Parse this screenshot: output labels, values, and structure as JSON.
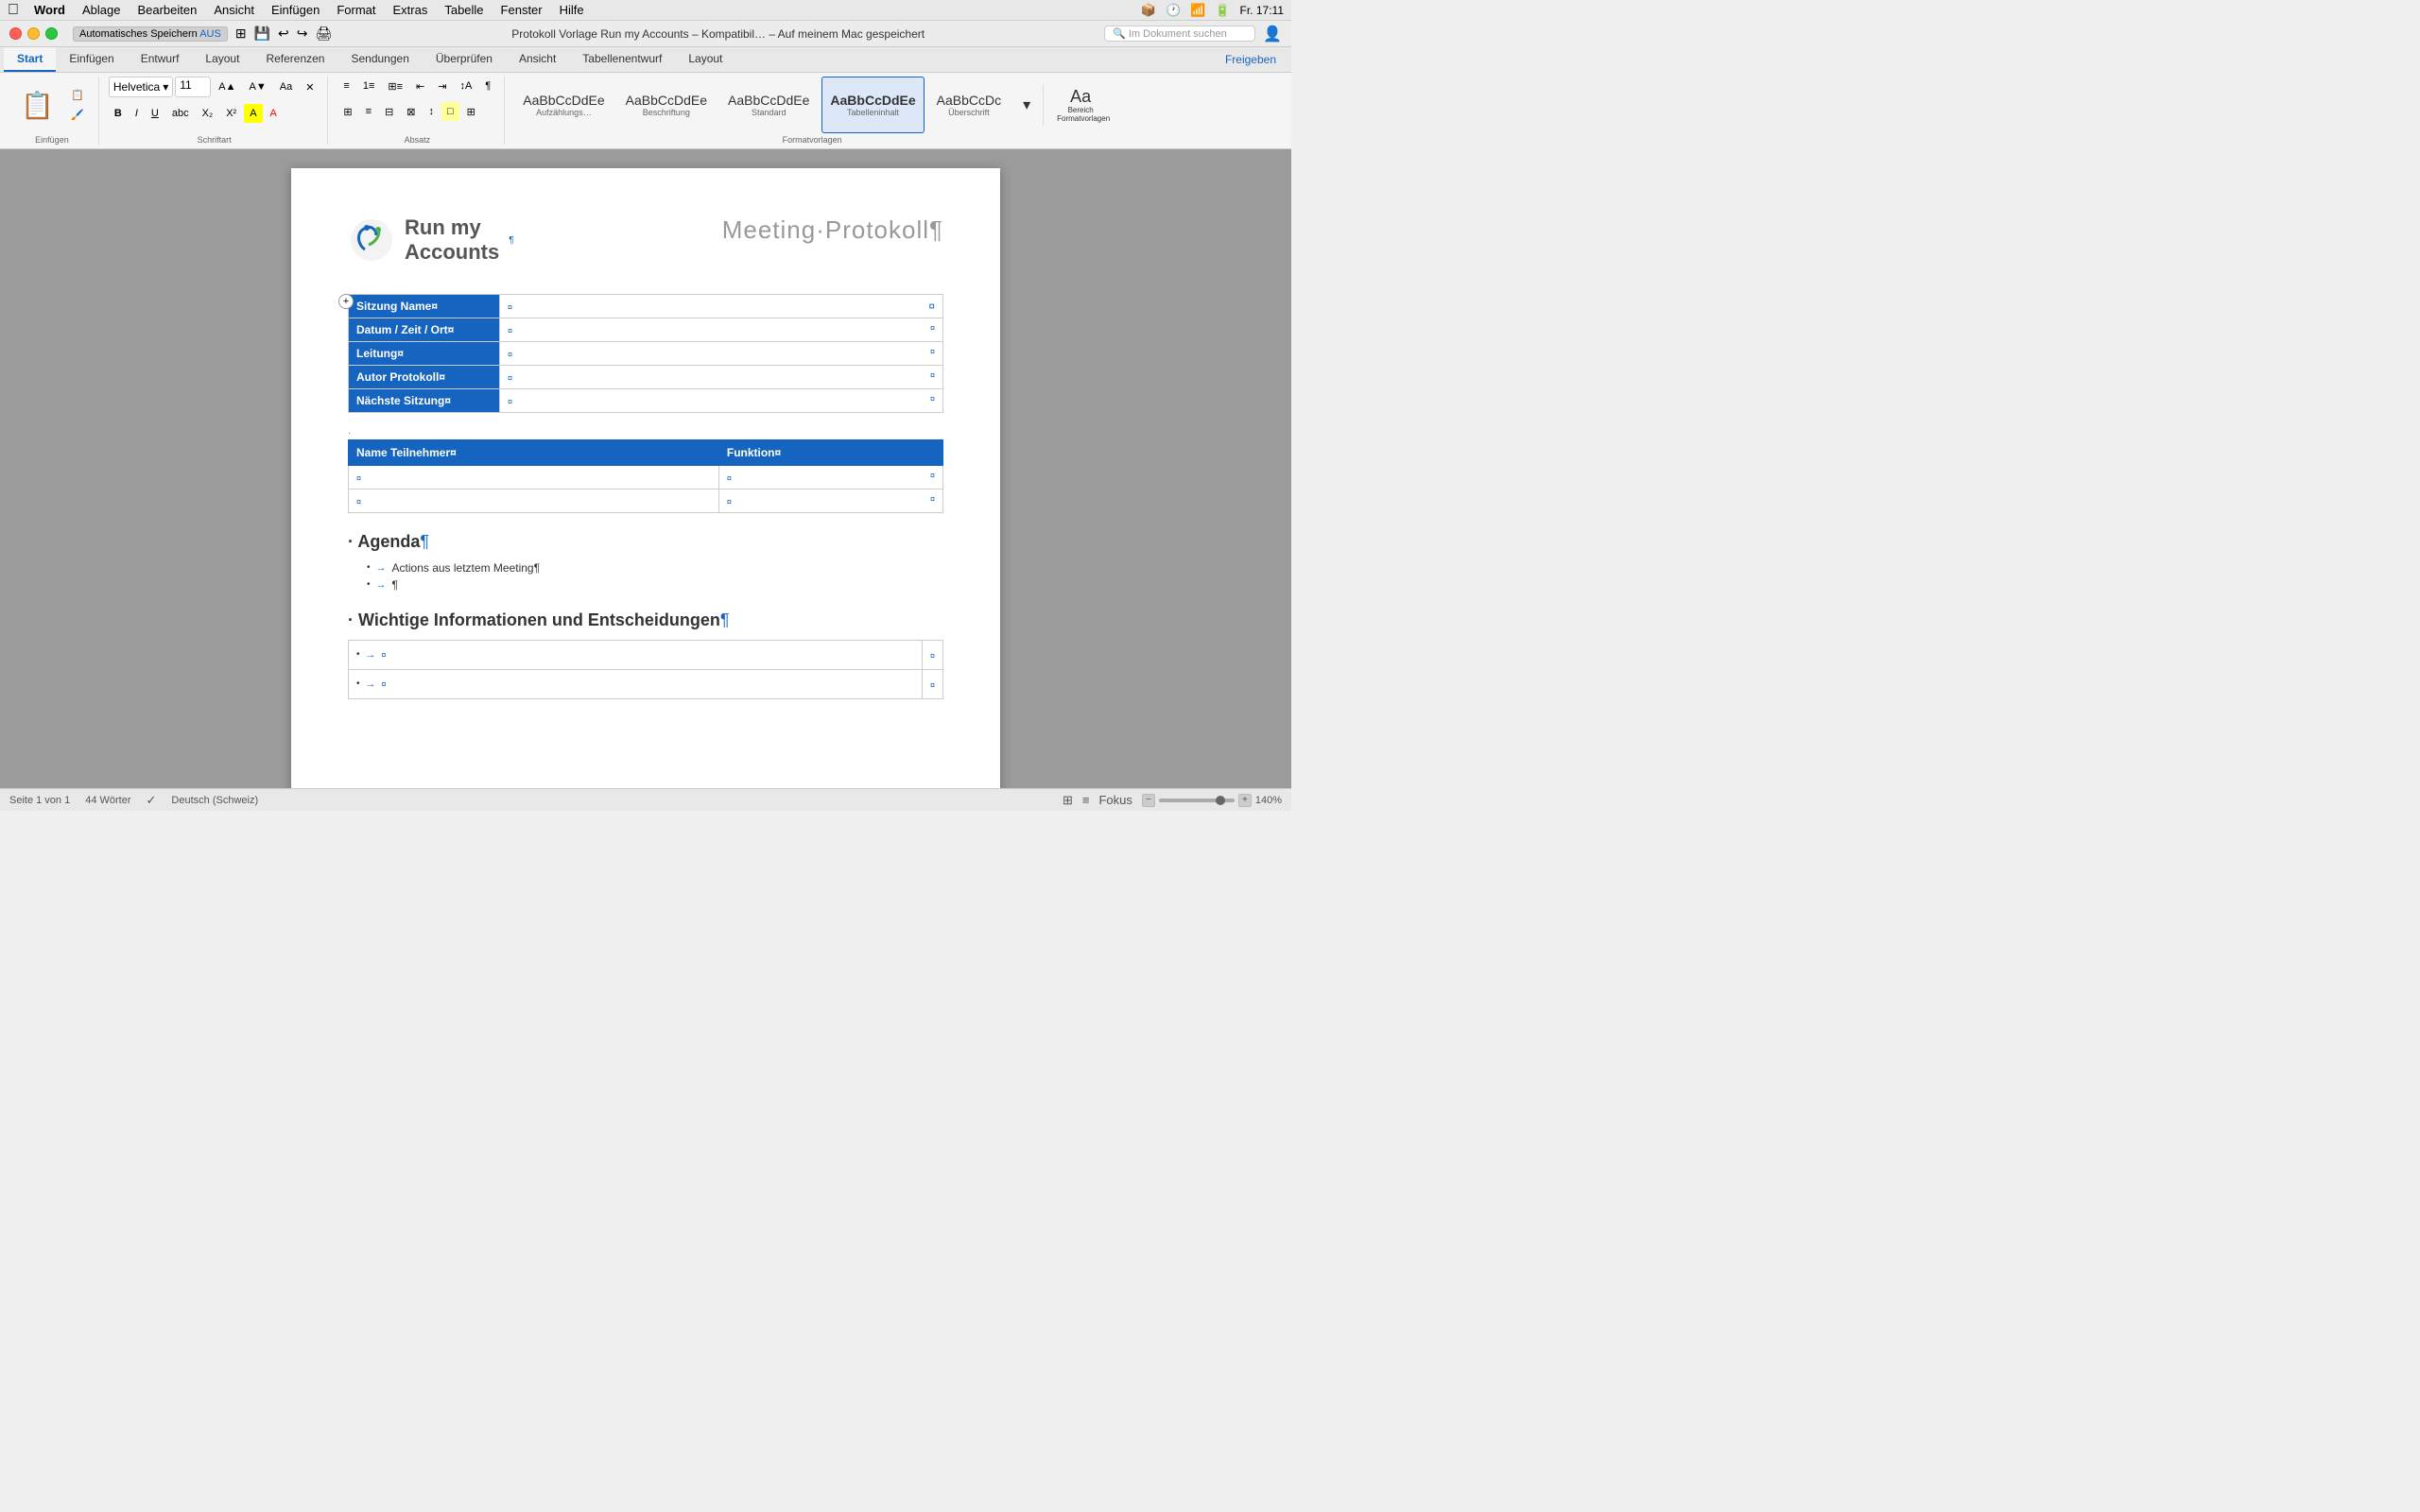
{
  "menubar": {
    "apple": "&#xF8FF;",
    "items": [
      "Word",
      "Ablage",
      "Bearbeiten",
      "Ansicht",
      "Einfügen",
      "Format",
      "Extras",
      "Tabelle",
      "Fenster",
      "Hilfe"
    ]
  },
  "titlebar": {
    "autosave_label": "Automatisches Speichern",
    "autosave_status": "AUS",
    "title": "Protokoll Vorlage Run my Accounts – Kompatibil… – Auf meinem Mac gespeichert",
    "search_placeholder": "Im Dokument suchen",
    "datetime": "Fr. 17:11"
  },
  "ribbon": {
    "tabs": [
      "Start",
      "Einfügen",
      "Entwurf",
      "Layout",
      "Referenzen",
      "Sendungen",
      "Überprüfen",
      "Ansicht",
      "Tabellenentwurf",
      "Layout"
    ],
    "active_tab": "Start",
    "share_label": "Freigeben",
    "font_name": "Helvetica",
    "font_size": "11",
    "styles": [
      {
        "label": "Aufzählungs…",
        "preview": "AaBbCcDdEe"
      },
      {
        "label": "Beschriftung",
        "preview": "AaBbCcDdEe"
      },
      {
        "label": "Standard",
        "preview": "AaBbCcDdEe"
      },
      {
        "label": "Tabelleninhalt",
        "preview": "AaBbCcDdEe",
        "active": true
      },
      {
        "label": "Überschrift",
        "preview": "AaBbCcDc"
      }
    ],
    "bereich_label": "Bereich Formatvorlagen",
    "einfuegen_label": "Einfügen"
  },
  "document": {
    "logo_line1": "Run my",
    "logo_line2": "Accounts",
    "title": "Meeting·Protokoll¶",
    "table_add_symbol": "+",
    "info_rows": [
      {
        "label": "Sitzung Name¤",
        "value": "¤"
      },
      {
        "label": "Datum / Zeit / Ort¤",
        "value": "¤"
      },
      {
        "label": "Leitung¤",
        "value": "¤"
      },
      {
        "label": "Autor Protokoll¤",
        "value": "¤"
      },
      {
        "label": "Nächste Sitzung¤",
        "value": "¤"
      }
    ],
    "participants_headers": [
      "Name Teilnehmer¤",
      "Funktion¤"
    ],
    "participants_rows": [
      [
        "¤",
        "¤"
      ],
      [
        "¤",
        "¤"
      ]
    ],
    "agenda_heading": "* Agenda¶",
    "agenda_items": [
      "Actions aus letztem Meeting¶",
      "¶"
    ],
    "wichtige_heading": "* Wichtige Informationen und Entscheidungen¶",
    "wichtige_items": [
      "¤",
      "¤"
    ]
  },
  "statusbar": {
    "page_info": "Seite 1 von 1",
    "word_count": "44 Wörter",
    "language": "Deutsch (Schweiz)",
    "focus_label": "Fokus",
    "zoom_level": "140%"
  }
}
